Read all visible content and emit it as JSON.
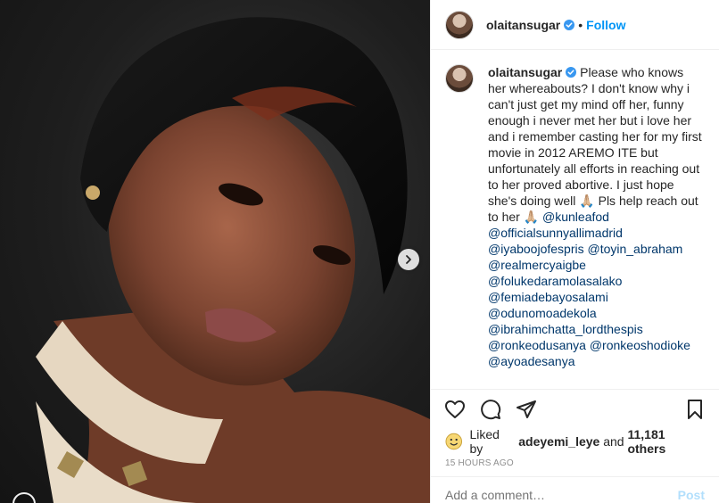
{
  "header": {
    "username": "olaitansugar",
    "separator": "•",
    "follow_label": "Follow"
  },
  "caption": {
    "username": "olaitansugar",
    "text": "Please who knows her whereabouts? I don't know why i can't just get my mind off her, funny enough i never met her but i love her and i remember casting her for my first movie in 2012 AREMO ITE but unfortunately all efforts in reaching out to her proved abortive. I just hope she's doing well 🙏🏼 Pls help reach out to her 🙏🏼",
    "first_tag": "@kunleafod",
    "tags": [
      "@officialsunnyallimadrid",
      "@iyaboojofespris @toyin_abraham",
      "@realmercyaigbe",
      "@folukedaramolasalako",
      "@femiadebayosalami",
      "@odunomoadekola",
      "@ibrahimchatta_lordthespis",
      "@ronkeodusanya @ronkeoshodioke",
      "@ayoadesanya"
    ]
  },
  "likes": {
    "prefix": "Liked by",
    "user": "adeyemi_leye",
    "middle": "and",
    "others": "11,181 others"
  },
  "timestamp": "15 HOURS AGO",
  "add_comment": {
    "placeholder": "Add a comment…",
    "post_label": "Post"
  },
  "colors": {
    "accent": "#0095f6",
    "link": "#00376b",
    "muted": "#8e8e8e"
  }
}
